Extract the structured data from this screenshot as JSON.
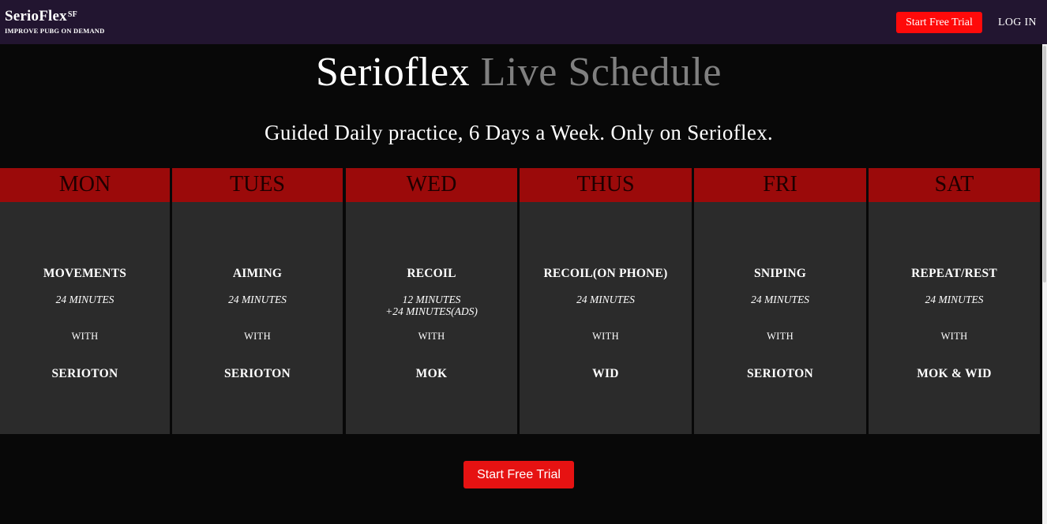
{
  "header": {
    "brand_name": "SerioFlex",
    "brand_badge": "SF",
    "tagline": "IMPROVE PUBG ON DEMAND",
    "cta_label": "Start Free Trial",
    "login_label": "LOG IN"
  },
  "hero": {
    "title_main": "Serioflex",
    "title_dim": "Live Schedule",
    "subtitle": "Guided Daily practice, 6 Days a Week. Only on Serioflex."
  },
  "schedule": [
    {
      "day": "MON",
      "topic": "MOVEMENTS",
      "duration": "24 MINUTES",
      "with": "WITH",
      "coach": "SERIOTON"
    },
    {
      "day": "TUES",
      "topic": "AIMING",
      "duration": "24 MINUTES",
      "with": "WITH",
      "coach": "SERIOTON"
    },
    {
      "day": "WED",
      "topic": "RECOIL",
      "duration": "12 MINUTES\n+24 MINUTES(ADS)",
      "with": "WITH",
      "coach": "MOK"
    },
    {
      "day": "THUS",
      "topic": "RECOIL(ON PHONE)",
      "duration": "24 MINUTES",
      "with": "WITH",
      "coach": "WID"
    },
    {
      "day": "FRI",
      "topic": "SNIPING",
      "duration": "24 MINUTES",
      "with": "WITH",
      "coach": "SERIOTON"
    },
    {
      "day": "SAT",
      "topic": "REPEAT/REST",
      "duration": "24 MINUTES",
      "with": "WITH",
      "coach": "MOK & WID"
    }
  ],
  "footer": {
    "cta_label": "Start Free Trial"
  },
  "colors": {
    "nav_bg": "#221530",
    "page_bg": "#080808",
    "card_bg": "#2b2b2b",
    "day_header_bg": "#9b0a0a",
    "cta_red": "#ff0a0a",
    "title_dim": "#808080"
  }
}
